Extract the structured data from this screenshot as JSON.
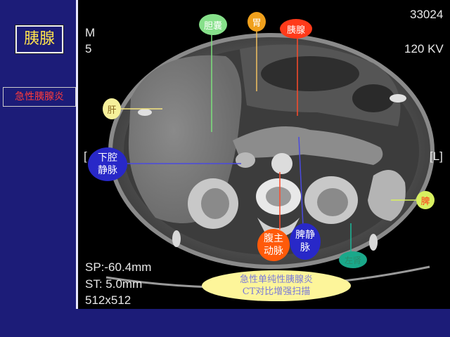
{
  "slide": {
    "title": "胰腺",
    "subtitle": "急性胰腺炎"
  },
  "ct_overlay": {
    "top_left_line1": "M",
    "top_left_line2": "5",
    "top_right_line1": "33024",
    "top_right_line2": "120 KV",
    "left_marker": "[",
    "right_marker": "[L]",
    "bottom_line1": "SP:-60.4mm",
    "bottom_line2": "ST:  5.0mm",
    "bottom_line3": "512x512"
  },
  "labels": {
    "gallbladder": "胆囊",
    "stomach": "胃",
    "pancreas": "胰腺",
    "liver": "肝",
    "ivc_line1": "下腔",
    "ivc_line2": "静脉",
    "spleen": "脾",
    "aorta_line1": "腹主",
    "aorta_line2": "动脉",
    "splenic_vein_line1": "脾静",
    "splenic_vein_line2": "脉",
    "kidney": "左肾"
  },
  "caption": {
    "line1": "急性单纯性胰腺炎",
    "line2": "CT对比增强扫描"
  },
  "colors": {
    "background": "#1c1c78",
    "title_text": "#ffe34d",
    "subtitle_text": "#ff3b3b",
    "green_bubble": "#86e08a",
    "orange_bubble": "#f08a1c",
    "red_bubble": "#ff3a1a",
    "yellow_bubble": "#fdf59a",
    "blue_bubble": "#2828c8",
    "teal_bubble": "#1aa88a"
  }
}
